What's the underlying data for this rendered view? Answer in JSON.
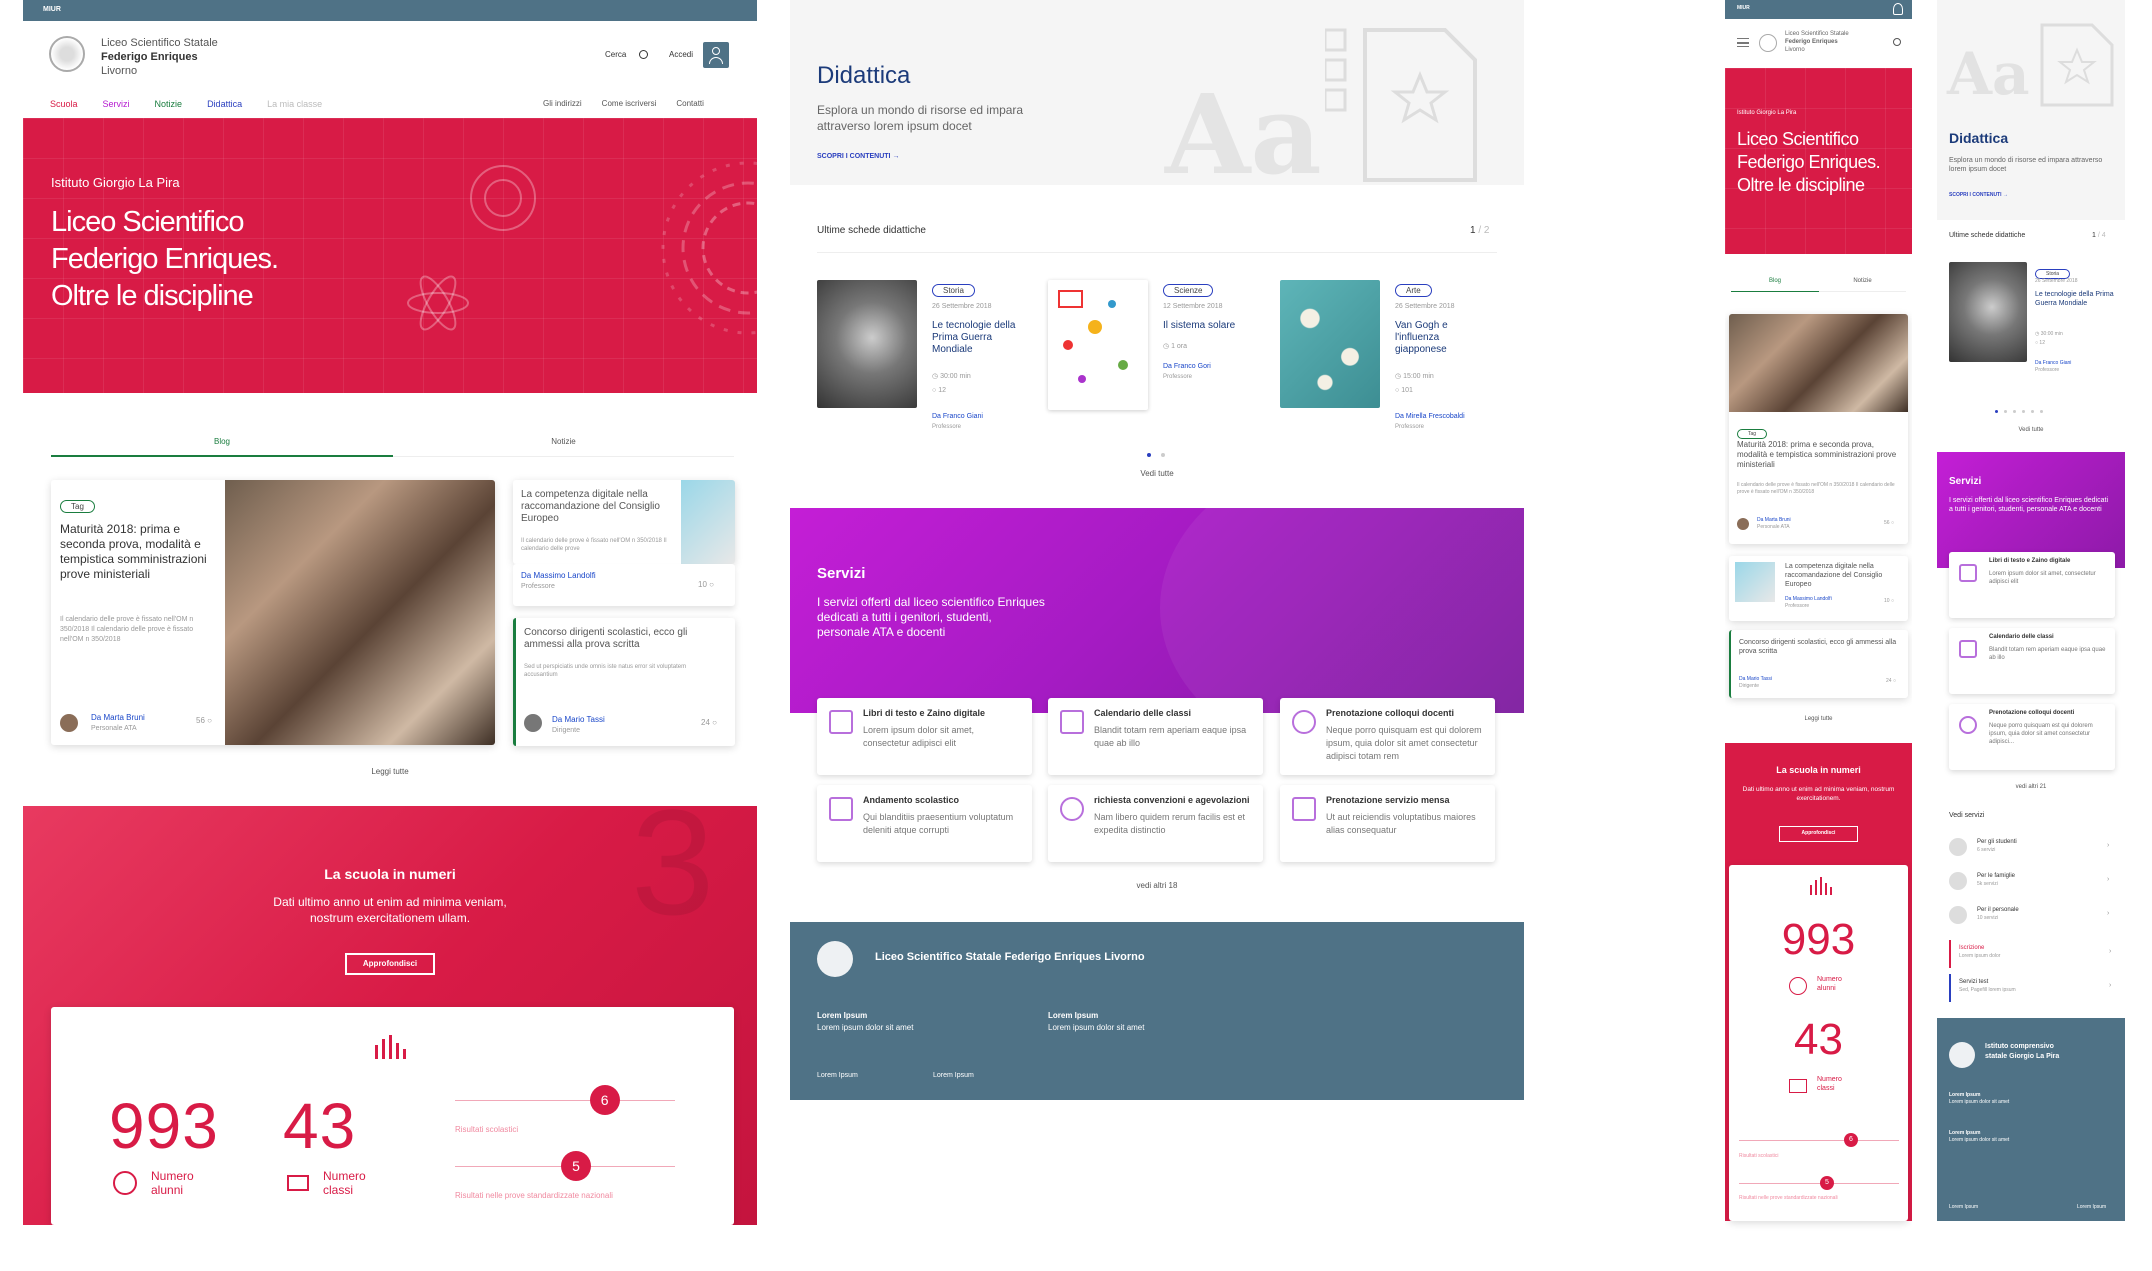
{
  "colors": {
    "crimson": "#d81b46",
    "magenta": "#b51ad0",
    "slate": "#4f7286",
    "blue": "#1a47c9",
    "green": "#1a7d3f"
  },
  "desk": {
    "topbar": {
      "label": "MIUR"
    },
    "brand": {
      "line1": "Liceo Scientifico Statale",
      "line2": "Federigo Enriques",
      "line3": "Livorno"
    },
    "header_actions": {
      "search": "Cerca",
      "login": "Accedi"
    },
    "nav": [
      "Scuola",
      "Servizi",
      "Notizie",
      "Didattica",
      "La mia classe"
    ],
    "nav_right": [
      "Gli indirizzi",
      "Come iscriversi",
      "Contatti"
    ],
    "hero": {
      "kicker": "Istituto Giorgio La Pira",
      "title_l1": "Liceo Scientifico",
      "title_l2": "Federigo Enriques.",
      "title_l3": "Oltre le discipline"
    },
    "tabs": [
      "Blog",
      "Notizie"
    ],
    "featured": {
      "tag": "Tag",
      "title": "Maturità 2018: prima e seconda prova, modalità e tempistica somministrazioni prove ministeriali",
      "excerpt": "Il calendario delle prove è fissato nell'OM n 350/2018 Il calendario delle prove è fissato nell'OM n 350/2018",
      "author": "Da Marta Bruni",
      "role": "Personale ATA",
      "comments": "56"
    },
    "side1": {
      "title": "La competenza digitale nella raccomandazione del Consiglio Europeo",
      "excerpt": "Il calendario delle prove è fissato nell'OM n 350/2018 Il calendario delle prove",
      "author": "Da Massimo Landolfi",
      "role": "Professore",
      "comments": "10"
    },
    "side2": {
      "title": "Concorso dirigenti scolastici, ecco gli ammessi alla prova scritta",
      "excerpt": "Sed ut perspiciatis unde omnis iste natus error sit voluptatem accusantium",
      "author": "Da Mario Tassi",
      "role": "Dirigente",
      "comments": "24"
    },
    "read_all": "Leggi tutte",
    "numbers": {
      "title": "La scuola in numeri",
      "sub1": "Dati ultimo anno ut enim ad minima veniam,",
      "sub2": "nostrum exercitationem ullam.",
      "button": "Approfondisci",
      "students": "993",
      "students_l1": "Numero",
      "students_l2": "alunni",
      "classes": "43",
      "classes_l1": "Numero",
      "classes_l2": "classi",
      "r1_value": "6",
      "r1_label": "Risultati scolastici",
      "r2_value": "5",
      "r2_label": "Risultati nelle prove standardizzate nazionali",
      "r1_frac": 0.68,
      "r2_frac": 0.55,
      "big_digit": "3"
    }
  },
  "mid": {
    "didattica": {
      "title": "Didattica",
      "sub1": "Esplora un mondo di risorse ed impara",
      "sub2": "attraverso lorem ipsum docet",
      "cta": "SCOPRI I CONTENUTI",
      "art": "Aa"
    },
    "latest": {
      "title": "Ultime schede didattiche",
      "page": "1",
      "pages": "/ 2"
    },
    "cards": [
      {
        "tag": "Storia",
        "date": "26 Settembre 2018",
        "title": "Le tecnologie della Prima Guerra Mondiale",
        "time": "30:00 min",
        "count": "12",
        "author": "Da Franco Giani",
        "role": "Professore"
      },
      {
        "tag": "",
        "date": "",
        "title": "",
        "time": "",
        "count": "",
        "author": "",
        "role": ""
      },
      {
        "tag": "Scienze",
        "date": "12 Settembre 2018",
        "title": "Il sistema solare",
        "time": "1 ora",
        "count": "",
        "author": "Da Franco Gori",
        "role": "Professore"
      },
      {
        "tag": "Arte",
        "date": "26 Settembre 2018",
        "title": "Van Gogh e l'influenza giapponese",
        "time": "15:00 min",
        "count": "101",
        "author": "Da Mirella Frescobaldi",
        "role": "Professore"
      }
    ],
    "see_all": "Vedi tutte",
    "servizi": {
      "title": "Servizi",
      "sub1": "I servizi offerti dal liceo scientifico Enriques",
      "sub2": "dedicati a tutti i genitori, studenti,",
      "sub3": "personale ATA e docenti"
    },
    "services": [
      {
        "title": "Libri di testo e Zaino digitale",
        "desc": "Lorem ipsum dolor sit amet, consectetur adipisci elit"
      },
      {
        "title": "Calendario delle classi",
        "desc": "Blandit totam rem aperiam eaque ipsa quae ab illo"
      },
      {
        "title": "Prenotazione colloqui docenti",
        "desc": "Neque porro quisquam est qui dolorem ipsum, quia dolor sit amet consectetur adipisci totam rem"
      },
      {
        "title": "Andamento scolastico",
        "desc": "Qui blanditiis praesentium voluptatum deleniti atque corrupti"
      },
      {
        "title": "richiesta convenzioni e agevolazioni",
        "desc": "Nam libero quidem rerum facilis est et expedita distinctio"
      },
      {
        "title": "Prenotazione servizio mensa",
        "desc": "Ut aut reiciendis voluptatibus maiores alias consequatur"
      }
    ],
    "see_more": "vedi altri 18",
    "footer": {
      "title": "Liceo Scientifico Statale Federigo Enriques Livorno",
      "c1h": "Lorem Ipsum",
      "c1t": "Lorem ipsum dolor sit amet",
      "c2h": "Lorem Ipsum",
      "c2t": "Lorem ipsum dolor sit amet",
      "l1": "Lorem Ipsum",
      "l2": "Lorem Ipsum"
    }
  },
  "mob1": {
    "topbar": "MIUR",
    "brand1": "Liceo Scientifico Statale",
    "brand2": "Federigo Enriques",
    "brand3": "Livorno",
    "hero_kicker": "Istituto Giorgio La Pira",
    "hero_l1": "Liceo Scientifico",
    "hero_l2": "Federigo Enriques.",
    "hero_l3": "Oltre le discipline",
    "tabs": [
      "Blog",
      "Notizie"
    ],
    "featured": {
      "tag": "Tag",
      "title": "Maturità 2018: prima e seconda prova, modalità e tempistica somministrazioni prove ministeriali",
      "excerpt": "Il calendario delle prove è fissato nell'OM n 350/2018 Il calendario delle prove è fissato nell'OM n 350/2018",
      "author": "Da Marta Bruni",
      "role": "Personale ATA",
      "comments": "56"
    },
    "item2": {
      "title": "La competenza digitale nella raccomandazione del Consiglio Europeo",
      "author": "Da Massimo Landolfi",
      "role": "Professore",
      "comments": "10"
    },
    "item3": {
      "title": "Concorso dirigenti scolastici, ecco gli ammessi alla prova scritta",
      "author": "Da Mario Tassi",
      "role": "Dirigente",
      "comments": "24"
    },
    "read_all": "Leggi tutte",
    "numbers": {
      "title": "La scuola in numeri",
      "sub": "Dati ultimo anno ut enim ad minima veniam, nostrum exercitationem.",
      "button": "Approfondisci",
      "students": "993",
      "sl1": "Numero",
      "sl2": "alunni",
      "classes": "43",
      "cl1": "Numero",
      "cl2": "classi",
      "r1": "6",
      "r1_label": "Risultati scolastici",
      "r2": "5",
      "r2_label": "Risultati nelle prove standardizzate nazionali",
      "r1_frac": 0.7,
      "r2_frac": 0.55
    }
  },
  "mob2": {
    "art": "Aa",
    "didattica": {
      "title": "Didattica",
      "sub": "Esplora un mondo di risorse ed impara attraverso lorem ipsum docet",
      "cta": "SCOPRI I CONTENUTI"
    },
    "latest": {
      "title": "Ultime schede didattiche",
      "page": "1",
      "pages": "/ 4"
    },
    "card": {
      "tag": "Storia",
      "date": "26 Settembre 2018",
      "title": "Le tecnologie della Prima Guerra Mondiale",
      "time": "30:00 min",
      "count": "12",
      "author": "Da Franco Giani",
      "role": "Professore"
    },
    "see_all": "Vedi tutte",
    "servizi": {
      "title": "Servizi",
      "sub": "I servizi offerti dal liceo scientifico Enriques dedicati a tutti i genitori, studenti, personale ATA e docenti"
    },
    "services": [
      {
        "title": "Libri di testo e Zaino digitale",
        "desc": "Lorem ipsum dolor sit amet, consectetur adipisci elit"
      },
      {
        "title": "Calendario delle classi",
        "desc": "Blandit totam rem aperiam eaque ipsa quae ab illo"
      },
      {
        "title": "Prenotazione colloqui docenti",
        "desc": "Neque porro quisquam est qui dolorem ipsum, quia dolor sit amet consectetur adipisci..."
      }
    ],
    "see_more": "vedi altri 21",
    "vedi": "Vedi servizi",
    "groups": [
      {
        "title": "Per gli studenti",
        "count": "6 servizi"
      },
      {
        "title": "Per le famiglie",
        "count": "5k servizi"
      },
      {
        "title": "Per il personale",
        "count": "10 servizi"
      },
      {
        "title": "Iscrizione",
        "count": "Lorem ipsum dolor"
      },
      {
        "title": "Servizi test",
        "count": "Sed, Pagefill lorem ipsum"
      }
    ],
    "footer": {
      "title1": "Istituto comprensivo",
      "title2": "statale Giorgio La Pira",
      "c1h": "Lorem Ipsum",
      "c1t": "Lorem ipsum dolor sit amet",
      "c2h": "Lorem Ipsum",
      "c2t": "Lorem ipsum dolor sit amet",
      "l1": "Lorem Ipsum",
      "l2": "Lorem Ipsum"
    }
  }
}
